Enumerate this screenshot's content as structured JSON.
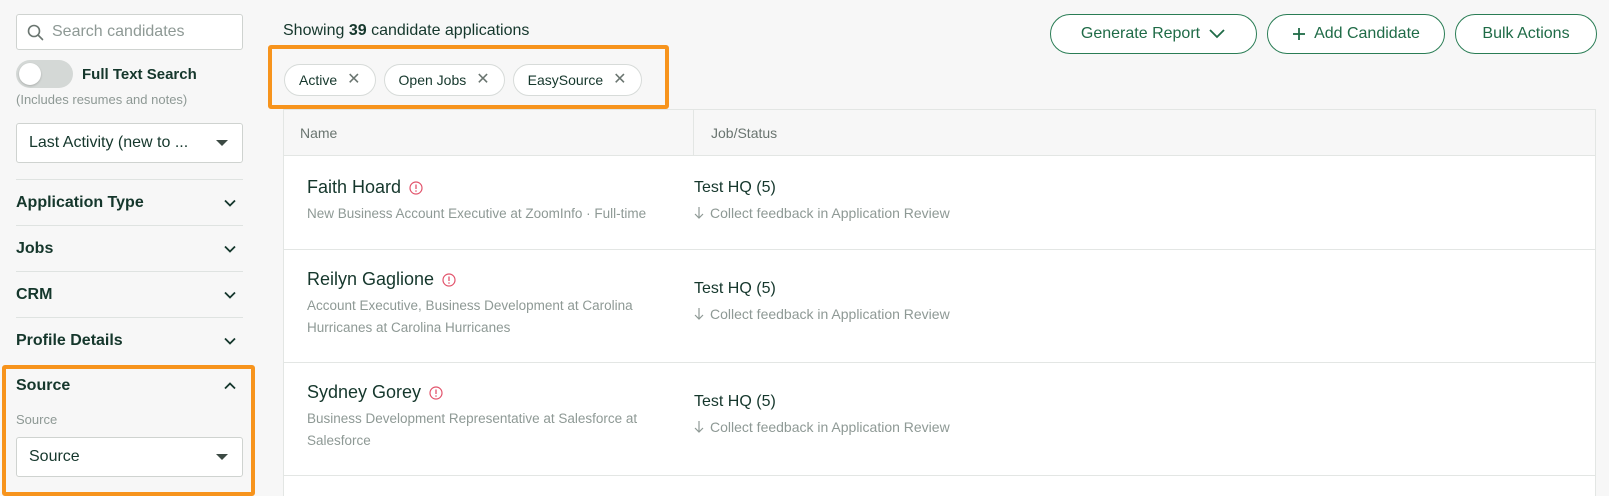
{
  "sidebar": {
    "search_placeholder": "Search candidates",
    "full_text_label": "Full Text Search",
    "full_text_hint": "(Includes resumes and notes)",
    "sort_value": "Last Activity (new to ...",
    "sections": [
      {
        "label": "Application Type",
        "icon": "chevron-down-icon"
      },
      {
        "label": "Jobs",
        "icon": "chevron-down-icon"
      },
      {
        "label": "CRM",
        "icon": "chevron-down-icon"
      },
      {
        "label": "Profile Details",
        "icon": "chevron-down-icon"
      },
      {
        "label": "Source",
        "icon": "chevron-up-icon"
      }
    ],
    "source_sublabel": "Source",
    "source_select_value": "Source"
  },
  "header": {
    "showing_prefix": "Showing ",
    "count": "39",
    "showing_suffix": " candidate applications",
    "generate_report": "Generate Report",
    "add_candidate": "Add Candidate",
    "bulk_actions": "Bulk Actions"
  },
  "filters": [
    "Active",
    "Open Jobs",
    "EasySource"
  ],
  "table": {
    "columns": [
      "Name",
      "Job/Status"
    ],
    "rows": [
      {
        "name": "Faith Hoard",
        "desc": "New Business Account Executive at ZoomInfo · Full-time",
        "job": "Test HQ (5)",
        "status": "Collect feedback in Application Review"
      },
      {
        "name": "Reilyn Gaglione",
        "desc": "Account Executive, Business Development at Carolina Hurricanes at Carolina Hurricanes",
        "job": "Test HQ (5)",
        "status": "Collect feedback in Application Review"
      },
      {
        "name": "Sydney Gorey",
        "desc": "Business Development Representative at Salesforce at Salesforce",
        "job": "Test HQ (5)",
        "status": "Collect feedback in Application Review"
      }
    ]
  },
  "colors": {
    "brand_green": "#1f6b47",
    "highlight_orange": "#f7941d",
    "alert_red": "#e2536b"
  }
}
